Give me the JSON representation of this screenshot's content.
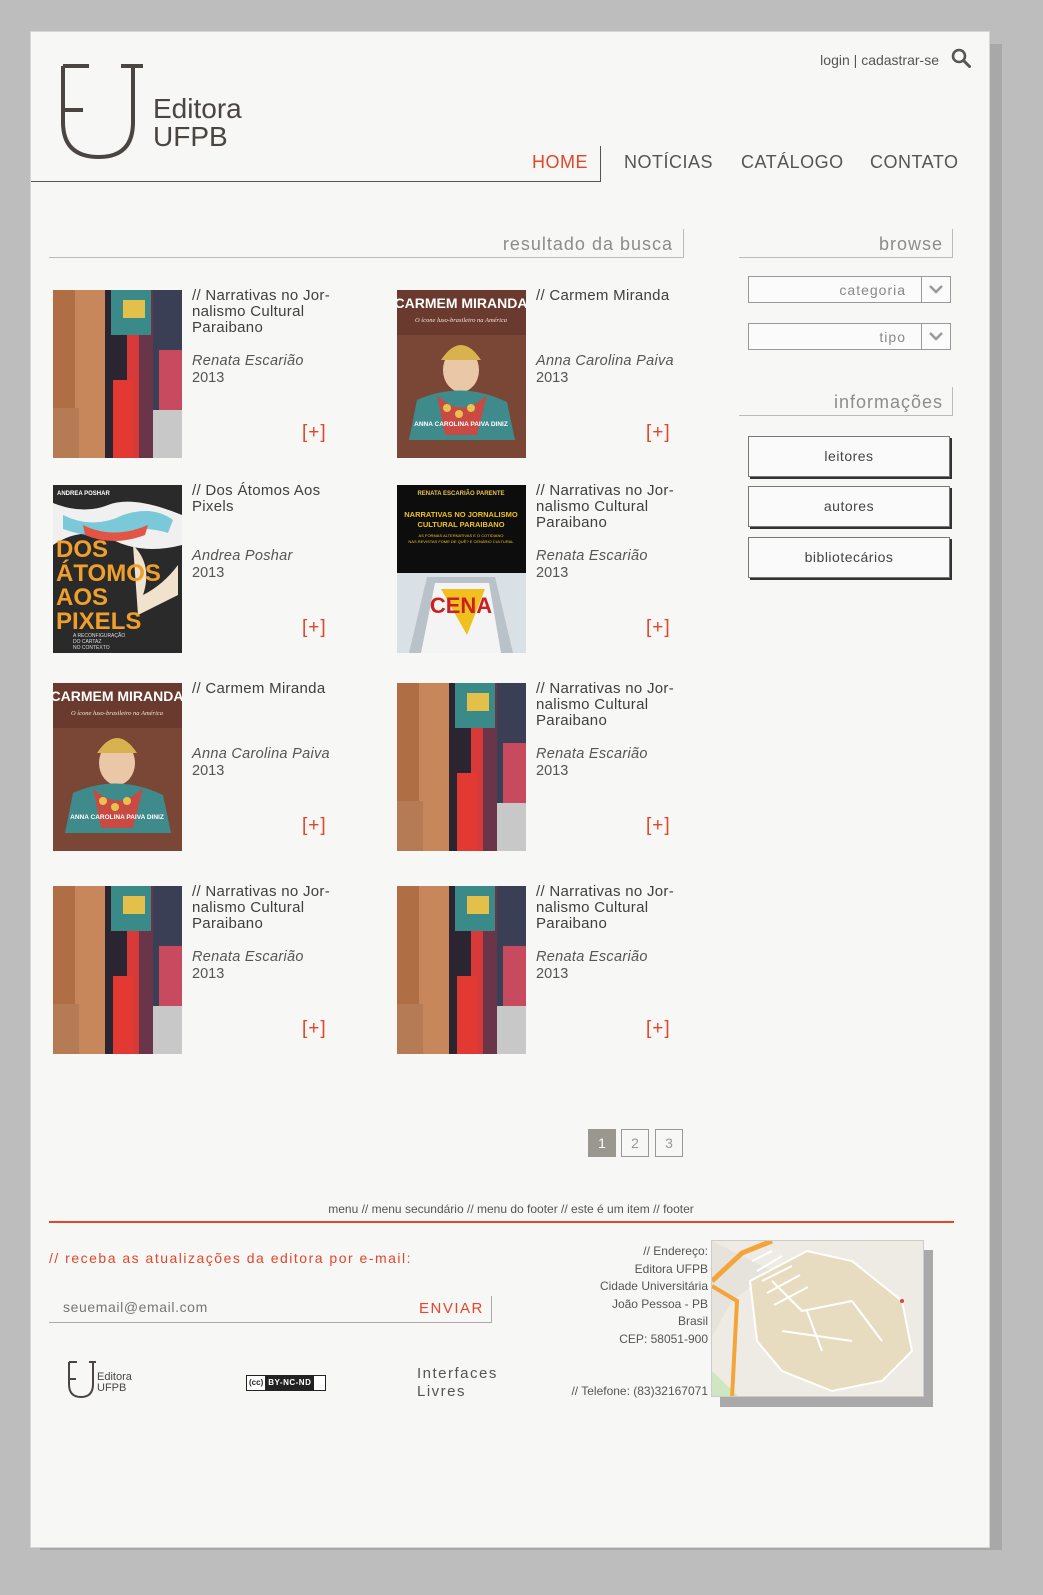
{
  "header": {
    "logo_name": "Editora",
    "logo_sub": "UFPB",
    "login": "login",
    "separator": "|",
    "signup": "cadastrar-se",
    "nav": [
      "HOME",
      "NOTÍCIAS",
      "CATÁLOGO",
      "CONTATO"
    ],
    "nav_active": "HOME"
  },
  "results": {
    "heading": "resultado da busca",
    "more_label": "[+]",
    "items": [
      {
        "title": "// Narrativas no Jor-nalismo Cultural Paraibano",
        "author": "Renata Escarião",
        "year": "2013",
        "cover": "festival"
      },
      {
        "title": "// Carmem Miranda",
        "author": "Anna Carolina Paiva",
        "year": "2013",
        "cover": "carmem"
      },
      {
        "title": "// Dos Átomos Aos Pixels",
        "author": "Andrea Poshar",
        "year": "2013",
        "cover": "dos-atomos"
      },
      {
        "title": "// Narrativas no Jor-nalismo Cultural Paraibano",
        "author": "Renata Escarião",
        "year": "2013",
        "cover": "narrativas"
      },
      {
        "title": "// Carmem Miranda",
        "author": "Anna Carolina Paiva",
        "year": "2013",
        "cover": "carmem"
      },
      {
        "title": "// Narrativas no Jor-nalismo Cultural Paraibano",
        "author": "Renata Escarião",
        "year": "2013",
        "cover": "festival"
      },
      {
        "title": "// Narrativas no Jor-nalismo Cultural Paraibano",
        "author": "Renata Escarião",
        "year": "2013",
        "cover": "festival"
      },
      {
        "title": "// Narrativas no Jor-nalismo Cultural Paraibano",
        "author": "Renata Escarião",
        "year": "2013",
        "cover": "festival"
      }
    ]
  },
  "covers": {
    "carmem_title": "CARMEM MIRANDA",
    "carmem_sub": "O ícone luso-brasileiro na América",
    "carmem_author": "ANNA CAROLINA PAIVA DINIZ",
    "dos_author": "ANDREA POSHAR",
    "dos_title_lines": [
      "DOS",
      "ÁTOMOS",
      "AOS",
      "PIXELS"
    ],
    "dos_sub_lines": [
      "A RECONFIGURAÇÃO",
      "DO CARTAZ",
      "NO CONTEXTO"
    ],
    "narr_author": "RENATA ESCARIÃO PARENTE",
    "narr_title_lines": [
      "NARRATIVAS NO JORNALISMO",
      "CULTURAL PARAIBANO"
    ],
    "narr_sub_lines": [
      "AS FORMAS ALTERNATIVAS E O COTIDIANO",
      "NAS REVISTAS FOME DE QUÊ? E CENÁRIO CULTURAL"
    ],
    "narr_mag": "CENA"
  },
  "sidebar": {
    "browse_heading": "browse",
    "category_select": "categoria",
    "type_select": "tipo",
    "info_heading": "informações",
    "buttons": [
      "leitores",
      "autores",
      "bibliotecários"
    ]
  },
  "pagination": {
    "pages": [
      "1",
      "2",
      "3"
    ],
    "current": "1"
  },
  "footer": {
    "menu": "menu // menu secundário // menu do footer // este é um item // footer",
    "newsletter_label": "// receba as atualizações da editora por e-mail:",
    "email_placeholder": "seuemail@email.com",
    "send_label": "ENVIAR",
    "address_lines": [
      "// Endereço:",
      "Editora UFPB",
      "Cidade Universitária",
      "João Pessoa - PB",
      "Brasil",
      "CEP: 58051-900"
    ],
    "phone": "// Telefone: (83)32167071",
    "interfaces_lines": [
      "Interfaces",
      "Livres"
    ],
    "cc_label": "BY-NC-ND",
    "cc_prefix": "(cc)"
  },
  "colors": {
    "accent": "#e4452b",
    "text": "#444444",
    "background": "#f7f7f5",
    "frame": "#bdbdbd"
  }
}
